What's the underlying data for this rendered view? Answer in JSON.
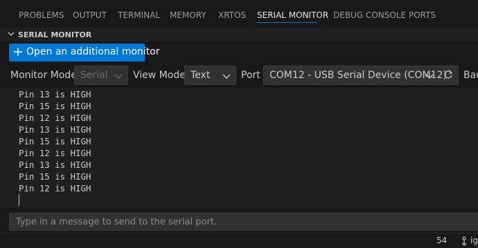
{
  "tabs": [
    {
      "label": "PROBLEMS"
    },
    {
      "label": "OUTPUT"
    },
    {
      "label": "TERMINAL"
    },
    {
      "label": "MEMORY"
    },
    {
      "label": "XRTOS"
    },
    {
      "label": "SERIAL MONITOR"
    },
    {
      "label": "DEBUG CONSOLE"
    },
    {
      "label": "PORTS"
    }
  ],
  "active_tab": "SERIAL MONITOR",
  "section": {
    "title": "SERIAL MONITOR"
  },
  "open_monitor_button": {
    "label": "Open an additional monitor"
  },
  "controls": {
    "monitor_mode": {
      "label": "Monitor Mode",
      "value": "Serial"
    },
    "view_mode": {
      "label": "View Mode",
      "value": "Text"
    },
    "port": {
      "label": "Port",
      "value": "COM12 - USB Serial Device (COM12)"
    },
    "baud": {
      "label": "Bau"
    }
  },
  "output_lines": [
    "Pin 13 is HIGH",
    "Pin 15 is HIGH",
    "Pin 12 is HIGH",
    "Pin 13 is HIGH",
    "Pin 15 is HIGH",
    "Pin 12 is HIGH",
    "Pin 13 is HIGH",
    "Pin 15 is HIGH",
    "Pin 12 is HIGH"
  ],
  "message_input": {
    "placeholder": "Type in a message to send to the serial port.",
    "value": ""
  },
  "status_bar": {
    "count": "54",
    "branch_text": "ig"
  },
  "colors": {
    "accent": "#0078d4",
    "background": "#181818",
    "panel": "#1f1f1f"
  },
  "icons": {
    "section_toggle": "chevron-down-icon",
    "add": "plus-icon",
    "dropdown": "chevron-down-icon",
    "refresh": "refresh-icon",
    "status": "git-branch-icon"
  }
}
